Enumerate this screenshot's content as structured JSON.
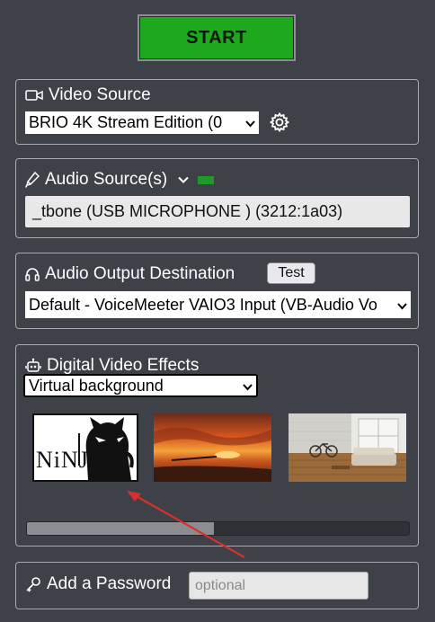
{
  "start_button": {
    "label": "START"
  },
  "video_source": {
    "title": "Video Source",
    "selected": "BRIO 4K Stream Edition (0",
    "icon": "video-camera-icon",
    "settings_icon": "gear-icon"
  },
  "audio_source": {
    "title": "Audio Source(s)",
    "device": "_tbone (USB MICROPHONE ) (3212:1a03)",
    "level_color": "#1f9a2a"
  },
  "audio_output": {
    "title": "Audio Output Destination",
    "test_label": "Test",
    "selected": "Default - VoiceMeeter VAIO3 Input (VB-Audio Vo"
  },
  "video_effects": {
    "title": "Digital Video Effects",
    "selected": "Virtual background",
    "backgrounds": [
      {
        "name": "ninja-logo-background",
        "logo_text": "NiNJA",
        "selected": true
      },
      {
        "name": "sunset-pier-background",
        "selected": false
      },
      {
        "name": "living-room-background",
        "selected": false
      }
    ],
    "progress_fraction": 0.49
  },
  "password": {
    "title": "Add a Password",
    "placeholder": "optional"
  },
  "colors": {
    "background": "#3e4148",
    "start_green": "#1ea81e",
    "annotation_arrow": "#d8302a"
  }
}
